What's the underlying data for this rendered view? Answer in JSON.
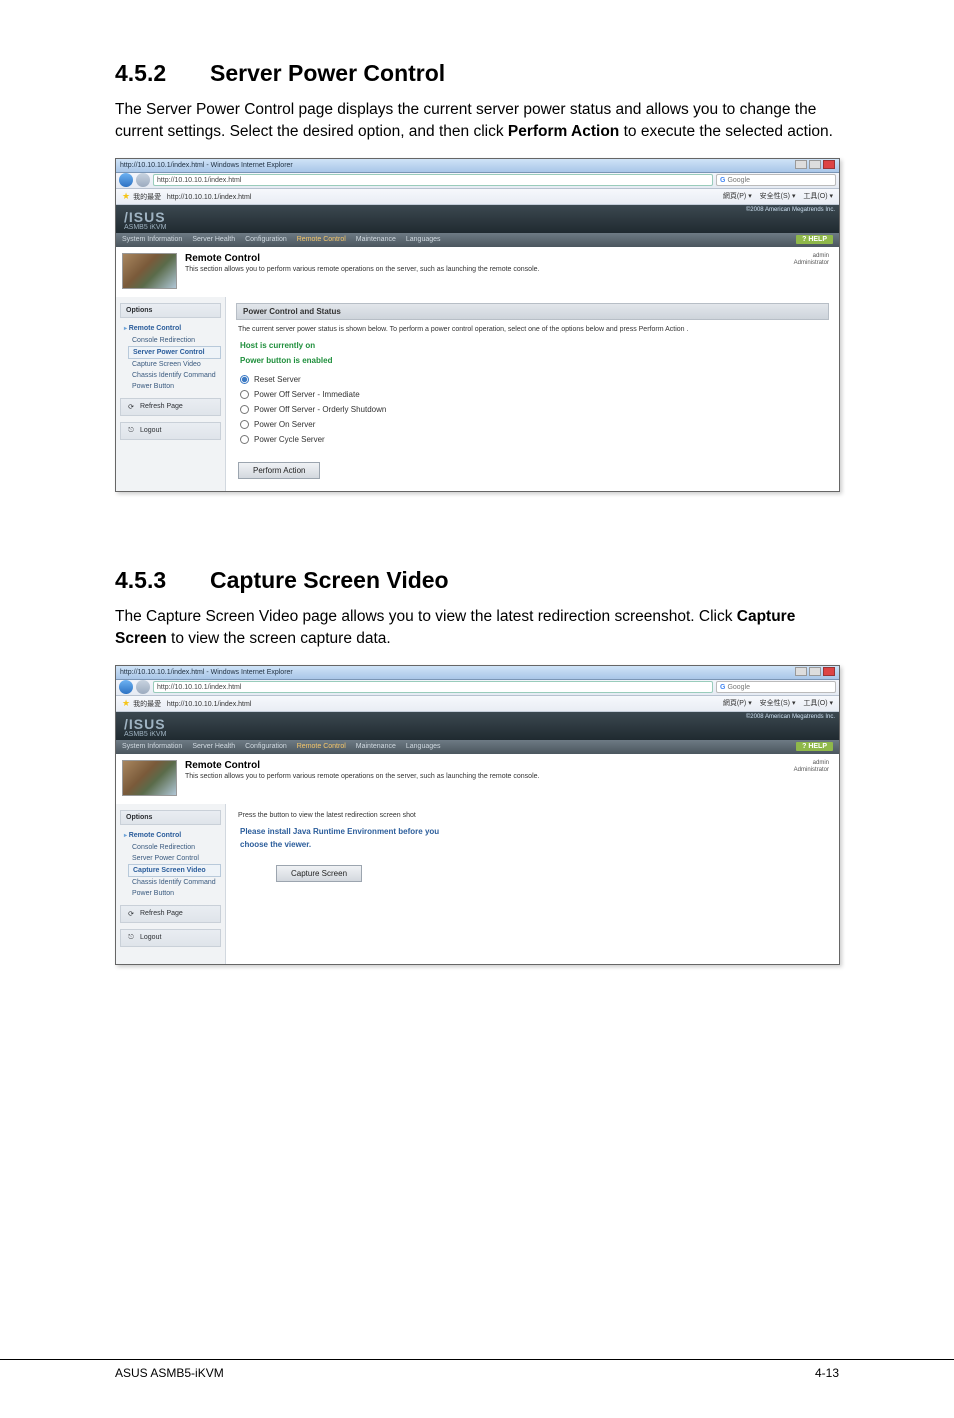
{
  "sections": {
    "s452": {
      "num": "4.5.2",
      "title": "Server Power Control",
      "body_pre": "The Server Power Control page displays the current server power status and allows you to change the current settings. Select the desired option, and then click ",
      "body_bold": "Perform Action",
      "body_post": " to execute the selected action."
    },
    "s453": {
      "num": "4.5.3",
      "title": "Capture Screen Video",
      "body_pre": "The Capture Screen Video page allows you to view the latest redirection screenshot. Click ",
      "body_bold": "Capture Screen",
      "body_post": " to view the screen capture data."
    }
  },
  "shot_common": {
    "window_title": "http://10.10.10.1/index.html - Windows Internet Explorer",
    "url": "http://10.10.10.1/index.html",
    "search_label": "Google",
    "fav_label": "我的最愛",
    "fav_item": "http://10.10.10.1/index.html",
    "tools": [
      "網頁(P) ▾",
      "安全性(S) ▾",
      "工具(O) ▾"
    ],
    "brand": "/ISUS",
    "brand_sub": "ASMB5 iKVM",
    "corner": "©2008 American Megatrends Inc.",
    "menu": [
      "System Information",
      "Server Health",
      "Configuration",
      "Remote Control",
      "Maintenance",
      "Languages"
    ],
    "menu_active_index": 3,
    "help": "? HELP",
    "page_title": "Remote Control",
    "page_sub": "This section allows you to perform various remote operations on the server, such as launching the remote console.",
    "user1": "admin",
    "user2": "Administrator",
    "options": "Options",
    "remote_control": "Remote Control",
    "refresh": "Refresh Page",
    "logout": "Logout"
  },
  "shot1": {
    "sidebar_items": [
      "Console Redirection",
      "Server Power Control",
      "Capture Screen Video",
      "Chassis Identify Command",
      "Power Button"
    ],
    "selected_index": 1,
    "panel_head": "Power Control and Status",
    "note": "The current server power status is shown below. To perform a power control operation, select one of the options below and press Perform Action .",
    "status_line1": "Host is currently on",
    "status_line2": "Power button is enabled",
    "radios": [
      "Reset Server",
      "Power Off Server - Immediate",
      "Power Off Server - Orderly Shutdown",
      "Power On Server",
      "Power Cycle Server"
    ],
    "checked_index": 0,
    "action_btn": "Perform Action"
  },
  "shot2": {
    "sidebar_items": [
      "Console Redirection",
      "Server Power Control",
      "Capture Screen Video",
      "Chassis Identify Command",
      "Power Button"
    ],
    "selected_index": 2,
    "note": "Press the button to view the latest redirection screen shot",
    "msg_line1": "Please install Java Runtime Environment before you",
    "msg_line2": "choose the viewer.",
    "action_btn": "Capture Screen"
  },
  "footer": {
    "left": "ASUS ASMB5-iKVM",
    "right": "4-13"
  }
}
